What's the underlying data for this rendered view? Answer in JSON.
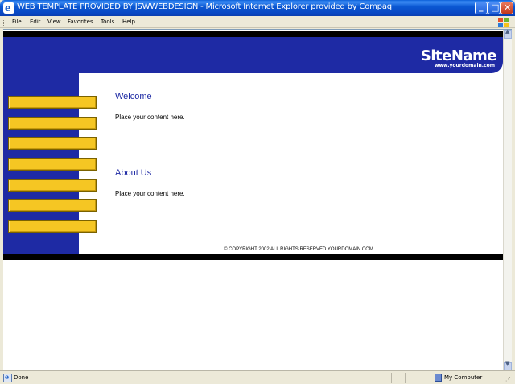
{
  "window": {
    "title": "WEB TEMPLATE PROVIDED BY JSWWEBDESIGN - Microsoft Internet Explorer provided by Compaq",
    "minimize_glyph": "_",
    "maximize_glyph": "□",
    "close_glyph": "✕"
  },
  "menu": {
    "items": [
      "File",
      "Edit",
      "View",
      "Favorites",
      "Tools",
      "Help"
    ]
  },
  "page": {
    "header": {
      "site_name": "SiteName",
      "site_url": "www.yourdomain.com"
    },
    "nav_button_count": 7,
    "sections": [
      {
        "heading": "Welcome",
        "body": "Place your content here."
      },
      {
        "heading": "About Us",
        "body": "Place your content here."
      }
    ],
    "copyright": "© COPYRIGHT 2002 ALL RIGHTS RESERVED YOURDOMAIN.COM",
    "colors": {
      "brand_blue": "#1e2aa4",
      "nav_yellow": "#f5c623",
      "black_bar": "#000000"
    }
  },
  "status": {
    "text": "Done",
    "zone": "My Computer"
  },
  "icons": {
    "title": "ie-logo-icon",
    "windows": "windows-flag-icon",
    "status": "page-done-icon",
    "zone": "my-computer-icon"
  }
}
